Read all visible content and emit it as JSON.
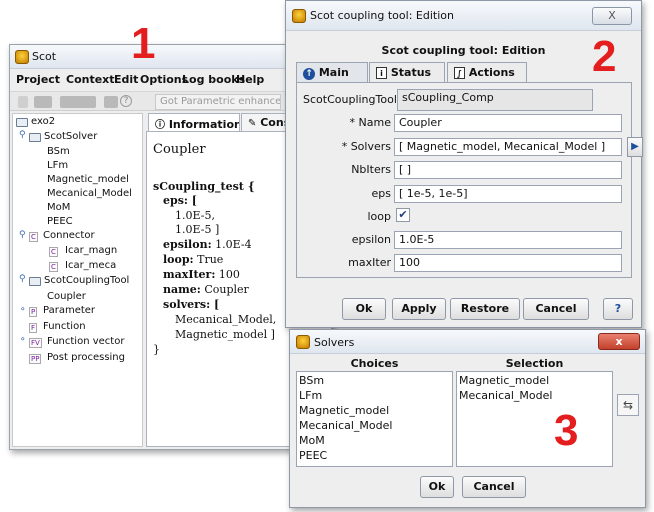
{
  "main_window": {
    "title": "Scot",
    "menu": [
      "Project",
      "Context",
      "Edit",
      "Options",
      "Log books",
      "Help"
    ],
    "toolbar_field": "Got Parametric enhanced",
    "tree": {
      "root": "exo2",
      "scot_solver": "ScotSolver",
      "solvers": [
        "BSm",
        "LFm",
        "Magnetic_model",
        "Mecanical_Model",
        "MoM",
        "PEEC"
      ],
      "connector_tag": "C",
      "connector": "Connector",
      "connectors_tag": "C",
      "connectors": [
        "Icar_magn",
        "Icar_meca"
      ],
      "coupling_tool": "ScotCouplingTool",
      "coupler": "Coupler",
      "parameter_tag": "P",
      "parameter": "Parameter",
      "function_tag": "F",
      "function": "Function",
      "function_vector_tag": "FV",
      "function_vector": "Function vector",
      "post_tag": "PP",
      "post_processing": "Post processing"
    },
    "tabs": [
      "Information",
      "Consol"
    ],
    "info": {
      "heading": "Coupler",
      "object": "sCoupling_test {",
      "eps_key": "eps: [",
      "eps_values": [
        "1.0E-5,",
        "1.0E-5 ]"
      ],
      "epsilon_key": "epsilon:",
      "epsilon_value": " 1.0E-4",
      "loop_key": "loop:",
      "loop_value": " True",
      "maxiter_key": "maxIter:",
      "maxiter_value": " 100",
      "name_key": "name:",
      "name_value": " Coupler",
      "solvers_key": "solvers: [",
      "solver_values": [
        "Mecanical_Model,",
        "Magnetic_model ]"
      ],
      "close": "}"
    }
  },
  "coupling_window": {
    "title": "Scot coupling tool: Edition",
    "close_label": "X",
    "heading": "Scot coupling tool: Edition",
    "tabs": [
      "Main",
      "Status",
      "Actions"
    ],
    "form": {
      "tool_label": "ScotCouplingTool",
      "tool_value": "sCoupling_Comp",
      "name_label": "* Name",
      "name_value": "Coupler",
      "solvers_label": "* Solvers",
      "solvers_value": "[ Magnetic_model, Mecanical_Model ]",
      "niters_label": "NbIters",
      "niters_value": "[ ]",
      "eps_label": "eps",
      "eps_value": "[ 1e-5,   1e-5]",
      "loop_label": "loop",
      "loop_checked": true,
      "epsilon_label": "epsilon",
      "epsilon_value": "1.0E-5",
      "maxiter_label": "maxIter",
      "maxiter_value": "100"
    },
    "buttons": [
      "Ok",
      "Apply",
      "Restore",
      "Cancel",
      "?"
    ]
  },
  "solvers_window": {
    "title": "Solvers",
    "close_label": "x",
    "choices_header": "Choices",
    "selection_header": "Selection",
    "choices": [
      "BSm",
      "LFm",
      "Magnetic_model",
      "Mecanical_Model",
      "MoM",
      "PEEC"
    ],
    "selection": [
      "Magnetic_model",
      "Mecanical_Model"
    ],
    "ok": "Ok",
    "cancel": "Cancel"
  },
  "annotations": [
    "1",
    "2",
    "3"
  ],
  "colors": {
    "annotation": "#e41e1e",
    "window_bg": "#eeeeee",
    "tag": "#7a1fa2"
  }
}
